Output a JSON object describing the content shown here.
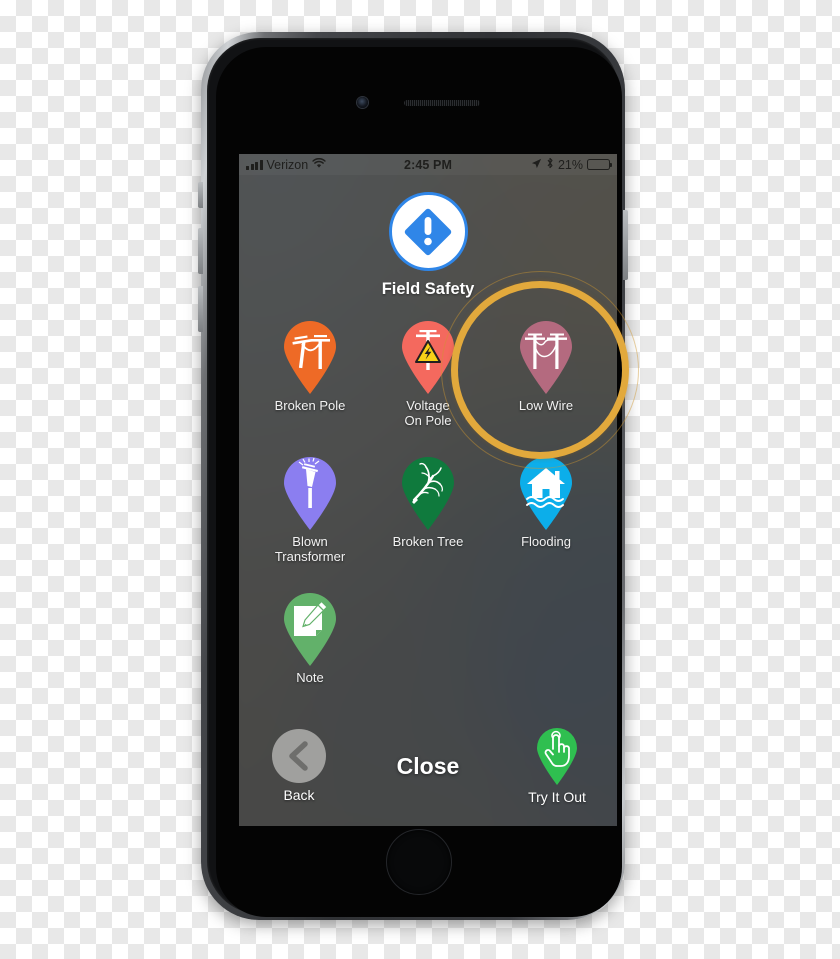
{
  "device": {
    "name": "iphone-mockup",
    "home_button": "home-button",
    "camera": "front-camera",
    "speaker": "earpiece-speaker"
  },
  "status_bar": {
    "carrier": "Verizon",
    "time": "2:45 PM",
    "battery_percent": "21%",
    "battery_level": 21,
    "signal_icon": "signal-bars-icon",
    "wifi_icon": "wifi-icon",
    "location_icon": "location-arrow-icon",
    "bluetooth_icon": "bluetooth-icon",
    "battery_icon": "battery-icon"
  },
  "header": {
    "title": "Field Safety",
    "icon": "alert-diamond-icon",
    "accent_color": "#2f86e8"
  },
  "grid": {
    "items": [
      {
        "label": "Broken Pole",
        "icon": "broken-pole-icon",
        "color": "#ee6a26",
        "name": "broken-pole"
      },
      {
        "label": "Voltage\nOn Pole",
        "icon": "voltage-on-pole-icon",
        "color": "#f4695e",
        "name": "voltage-on-pole"
      },
      {
        "label": "Low Wire",
        "icon": "low-wire-icon",
        "color": "#b46a7f",
        "name": "low-wire",
        "highlighted": true
      },
      {
        "label": "Blown\nTransformer",
        "icon": "blown-transformer-icon",
        "color": "#8b7ef0",
        "name": "blown-transformer"
      },
      {
        "label": "Broken Tree",
        "icon": "broken-tree-icon",
        "color": "#0f7a3d",
        "name": "broken-tree"
      },
      {
        "label": "Flooding",
        "icon": "flooding-house-icon",
        "color": "#0caeea",
        "name": "flooding"
      },
      {
        "label": "Note",
        "icon": "note-pencil-icon",
        "color": "#62b16a",
        "name": "note"
      }
    ]
  },
  "bottom_bar": {
    "back_label": "Back",
    "back_icon": "chevron-left-icon",
    "close_label": "Close",
    "try_it_out_label": "Try It Out",
    "try_it_out_icon": "tap-hand-icon",
    "try_it_out_color": "#2fbf50"
  },
  "annotation": {
    "type": "highlight-ring",
    "target": "low-wire",
    "color": "#e2a93c"
  }
}
